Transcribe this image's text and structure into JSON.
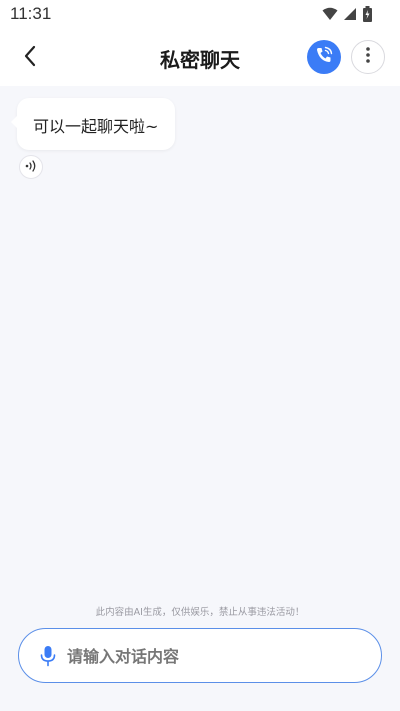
{
  "status_bar": {
    "time": "11:31",
    "icons": [
      "wifi-icon",
      "cellular-signal-icon",
      "battery-charging-icon"
    ]
  },
  "header": {
    "title": "私密聊天",
    "back_icon": "chevron-left-icon",
    "call_icon": "phone-call-icon",
    "more_icon": "more-vertical-icon"
  },
  "messages": [
    {
      "sender": "ai",
      "text": "可以一起聊天啦~",
      "voice_icon": "speaker-wave-icon"
    }
  ],
  "footer": {
    "disclaimer": "此内容由AI生成，仅供娱乐，禁止从事违法活动！",
    "input_placeholder": "请输入对话内容",
    "input_value": "",
    "mic_icon": "microphone-icon"
  },
  "colors": {
    "accent": "#3b7cf6",
    "input_border": "#5b8fe8",
    "background": "#f6f7fb",
    "bubble": "#ffffff"
  }
}
